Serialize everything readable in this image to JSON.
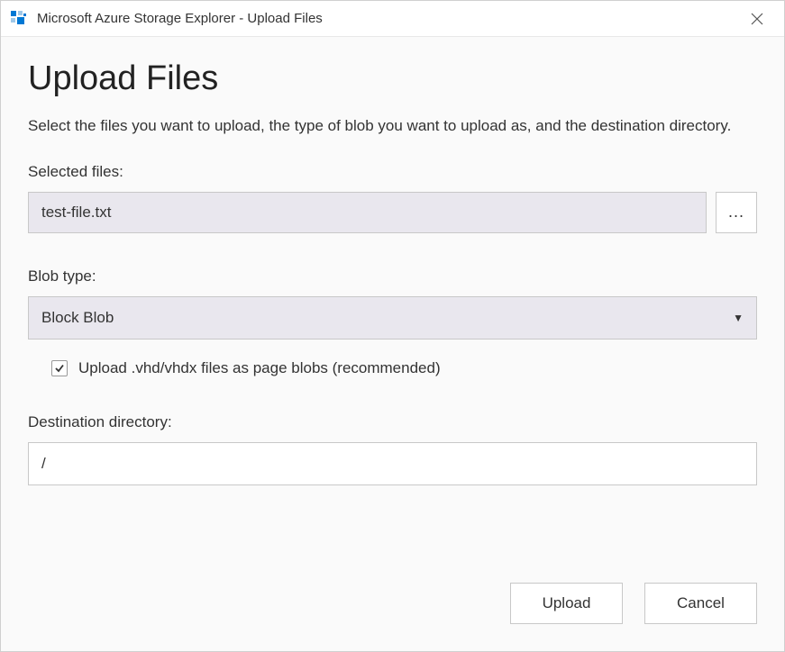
{
  "window": {
    "title": "Microsoft Azure Storage Explorer - Upload Files"
  },
  "page": {
    "title": "Upload Files",
    "description": "Select the files you want to upload, the type of blob you want to upload as, and the destination directory."
  },
  "selectedFiles": {
    "label": "Selected files:",
    "value": "test-file.txt",
    "browseLabel": "..."
  },
  "blobType": {
    "label": "Blob type:",
    "value": "Block Blob"
  },
  "vhdCheckbox": {
    "checked": true,
    "label": "Upload .vhd/vhdx files as page blobs (recommended)"
  },
  "destination": {
    "label": "Destination directory:",
    "value": "/"
  },
  "buttons": {
    "upload": "Upload",
    "cancel": "Cancel"
  }
}
